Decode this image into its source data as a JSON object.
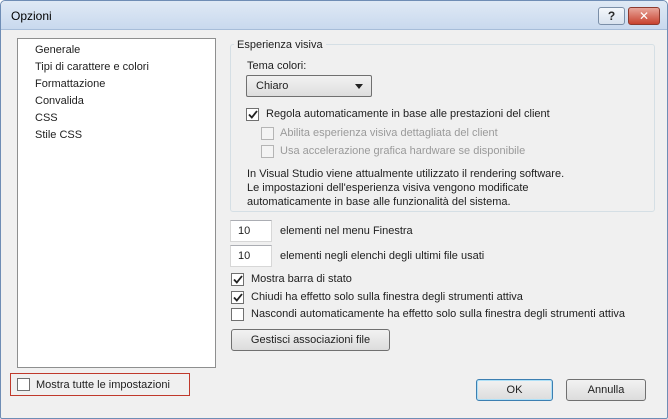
{
  "window": {
    "title": "Opzioni"
  },
  "titlebar": {
    "help_glyph": "?",
    "close_glyph": "✕"
  },
  "tree": {
    "items": [
      {
        "label": "Generale"
      },
      {
        "label": "Tipi di carattere e colori"
      },
      {
        "label": "Formattazione"
      },
      {
        "label": "Convalida"
      },
      {
        "label": "CSS"
      },
      {
        "label": "Stile CSS"
      }
    ]
  },
  "show_all": {
    "label": "Mostra tutte le impostazioni",
    "checked": false
  },
  "visual": {
    "group_title": "Esperienza visiva",
    "theme_label": "Tema colori:",
    "theme_value": "Chiaro",
    "auto_adjust": {
      "label": "Regola automaticamente in base alle prestazioni del client",
      "checked": true
    },
    "rich_visual": {
      "label": "Abilita esperienza visiva dettagliata del client",
      "checked": false,
      "enabled": false
    },
    "hw_accel": {
      "label": "Usa accelerazione grafica hardware se disponibile",
      "checked": false,
      "enabled": false
    },
    "info_line1": "In Visual Studio viene attualmente utilizzato il rendering software.",
    "info_line2": "Le impostazioni dell'esperienza visiva vengono modificate",
    "info_line3": "automaticamente in base alle funzionalità del sistema."
  },
  "window_menu": {
    "value": "10",
    "label": "elementi nel menu Finestra"
  },
  "mru": {
    "value": "10",
    "label": "elementi negli elenchi degli ultimi file usati"
  },
  "options": {
    "status_bar": {
      "label": "Mostra barra di stato",
      "checked": true
    },
    "close_active": {
      "label": "Chiudi ha effetto solo sulla finestra degli strumenti attiva",
      "checked": true
    },
    "autohide_active": {
      "label": "Nascondi automaticamente ha effetto solo sulla finestra degli strumenti attiva",
      "checked": false
    }
  },
  "buttons": {
    "file_assoc": "Gestisci associazioni file",
    "ok": "OK",
    "cancel": "Annulla"
  },
  "colors": {
    "titlebar": "#c9d9ee",
    "highlight_border": "#c0392b",
    "default_button_border": "#3c7fb1"
  },
  "icons": {
    "check": "checkmark-icon",
    "dropdown": "chevron-down-icon"
  }
}
